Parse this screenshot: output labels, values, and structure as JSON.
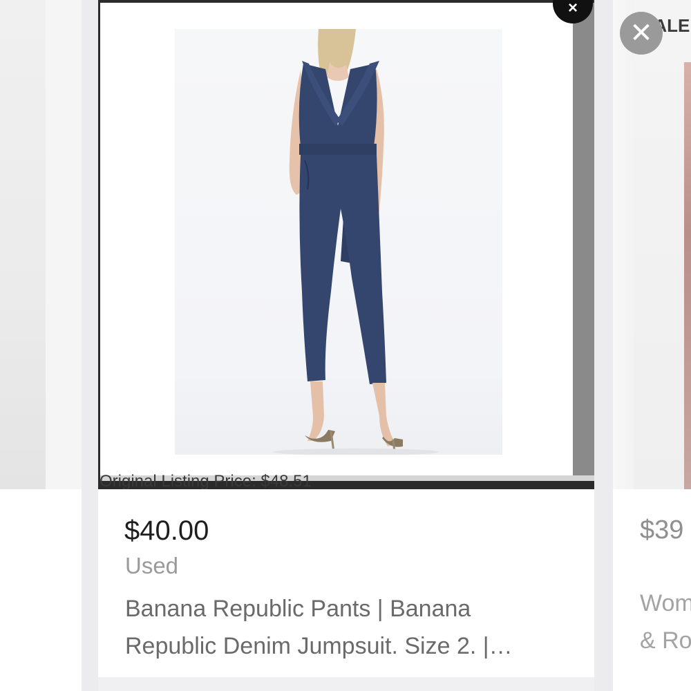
{
  "main_card": {
    "original_listing_price": "Original Listing Price: $48.51",
    "price": "$40.00",
    "condition": "Used",
    "title_line1": "Banana Republic Pants | Banana",
    "title_line2": "Republic Denim Jumpsuit. Size 2. |…"
  },
  "right_card": {
    "badge": "SALE",
    "price": "$39",
    "title_line1": "Wom",
    "title_line2": "& Ro"
  },
  "icons": {
    "close_badge": "×",
    "close_icon": "✕"
  }
}
